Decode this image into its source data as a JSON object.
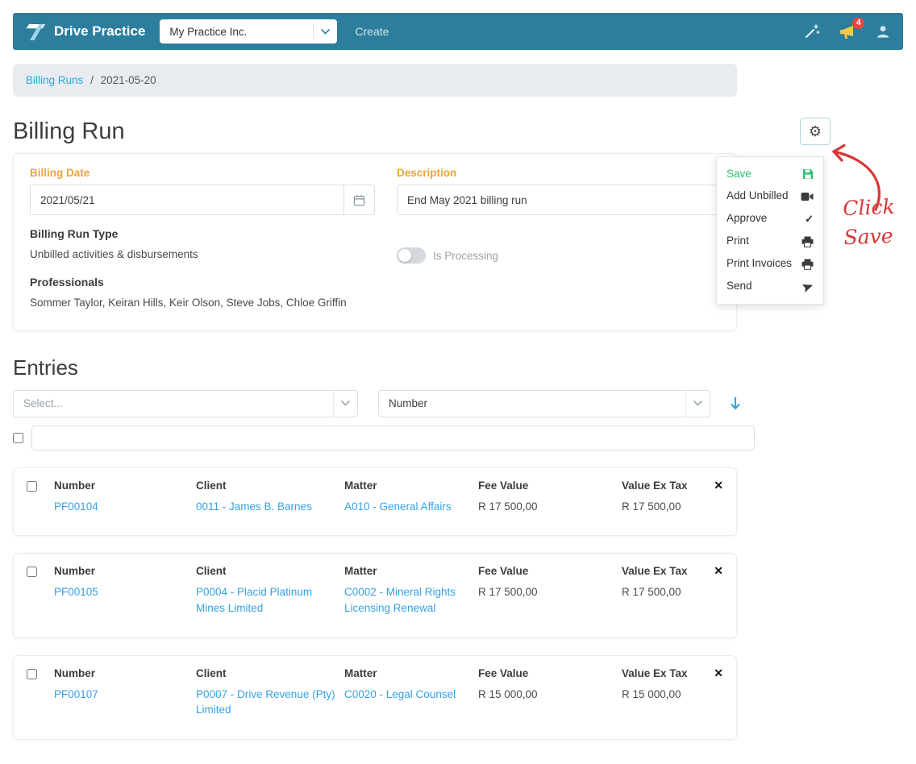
{
  "navbar": {
    "brand": "Drive Practice",
    "practice_name": "My Practice Inc.",
    "create_label": "Create",
    "notification_badge": "4"
  },
  "breadcrumb": {
    "root": "Billing Runs",
    "separator": "/",
    "current": "2021-05-20"
  },
  "page": {
    "title": "Billing Run"
  },
  "gear_menu": {
    "items": [
      {
        "label": "Save",
        "icon": "save-icon"
      },
      {
        "label": "Add Unbilled",
        "icon": "camera-icon"
      },
      {
        "label": "Approve",
        "icon": "check-icon"
      },
      {
        "label": "Print",
        "icon": "printer-icon"
      },
      {
        "label": "Print Invoices",
        "icon": "printer-icon"
      },
      {
        "label": "Send",
        "icon": "send-icon"
      }
    ]
  },
  "annotation": {
    "line1": "Click",
    "line2": "Save"
  },
  "form": {
    "billing_date": {
      "label": "Billing Date",
      "value": "2021/05/21"
    },
    "description": {
      "label": "Description",
      "value": "End May 2021 billing run"
    },
    "billing_run_type": {
      "label": "Billing Run Type",
      "value": "Unbilled activities & disbursements"
    },
    "is_processing_label": "Is Processing",
    "professionals": {
      "label": "Professionals",
      "value": "Sommer Taylor, Keiran Hills, Keir Olson, Steve Jobs, Chloe Griffin"
    }
  },
  "entries": {
    "title": "Entries",
    "filter_placeholder": "Select...",
    "sort_field": "Number",
    "columns": [
      "Number",
      "Client",
      "Matter",
      "Fee Value",
      "Value Ex Tax"
    ],
    "rows": [
      {
        "number": "PF00104",
        "client": "0011 - James B. Barnes",
        "matter": "A010 - General Affairs",
        "fee_value": "R 17 500,00",
        "value_ex_tax": "R 17 500,00"
      },
      {
        "number": "PF00105",
        "client": "P0004 - Placid Platinum Mines Limited",
        "matter": "C0002 - Mineral Rights Licensing Renewal",
        "fee_value": "R 17 500,00",
        "value_ex_tax": "R 17 500,00"
      },
      {
        "number": "PF00107",
        "client": "P0007 - Drive Revenue (Pty) Limited",
        "matter": "C0020 - Legal Counsel",
        "fee_value": "R 15 000,00",
        "value_ex_tax": "R 15 000,00"
      }
    ]
  },
  "colors": {
    "navbar_teal": "#2d7e9d",
    "link_blue": "#35a2e6",
    "label_orange": "#eaa43f",
    "save_green": "#2bbf6e",
    "annotation_red": "#d93636"
  }
}
